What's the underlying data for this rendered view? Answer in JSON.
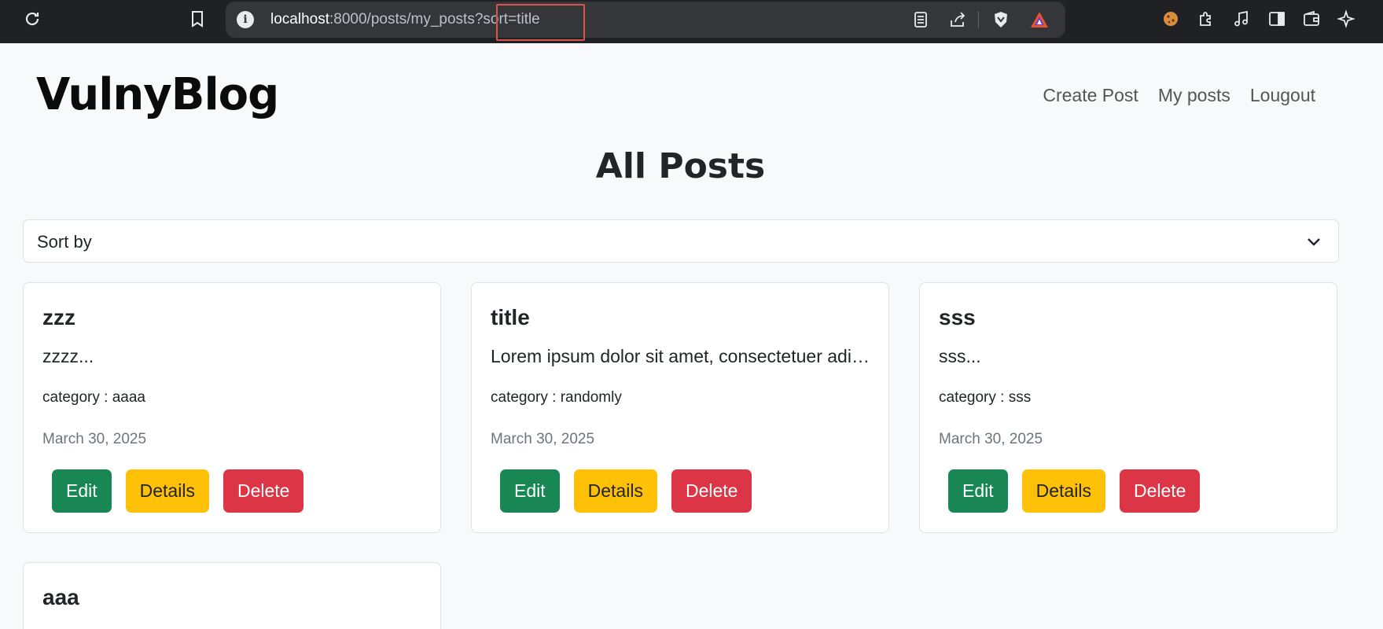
{
  "browser": {
    "url_host": "localhost",
    "url_path": ":8000/posts/my_posts",
    "url_query": "?sort=title"
  },
  "site": {
    "brand": "VulnyBlog",
    "nav": [
      "Create Post",
      "My posts",
      "Lougout"
    ]
  },
  "main": {
    "title": "All Posts",
    "sort_label": "Sort by"
  },
  "posts": [
    {
      "title": "zzz",
      "excerpt": "zzzz...",
      "category": "category : aaaa",
      "date": "March 30, 2025"
    },
    {
      "title": "title",
      "excerpt": "Lorem ipsum dolor sit amet, consectetuer adipiscing elit...",
      "category": "category : randomly",
      "date": "March 30, 2025"
    },
    {
      "title": "sss",
      "excerpt": "sss...",
      "category": "category : sss",
      "date": "March 30, 2025"
    },
    {
      "title": "aaa"
    }
  ],
  "buttons": {
    "edit": "Edit",
    "details": "Details",
    "delete": "Delete"
  },
  "colors": {
    "edit": "#198754",
    "details": "#ffc107",
    "delete": "#dc3545"
  }
}
